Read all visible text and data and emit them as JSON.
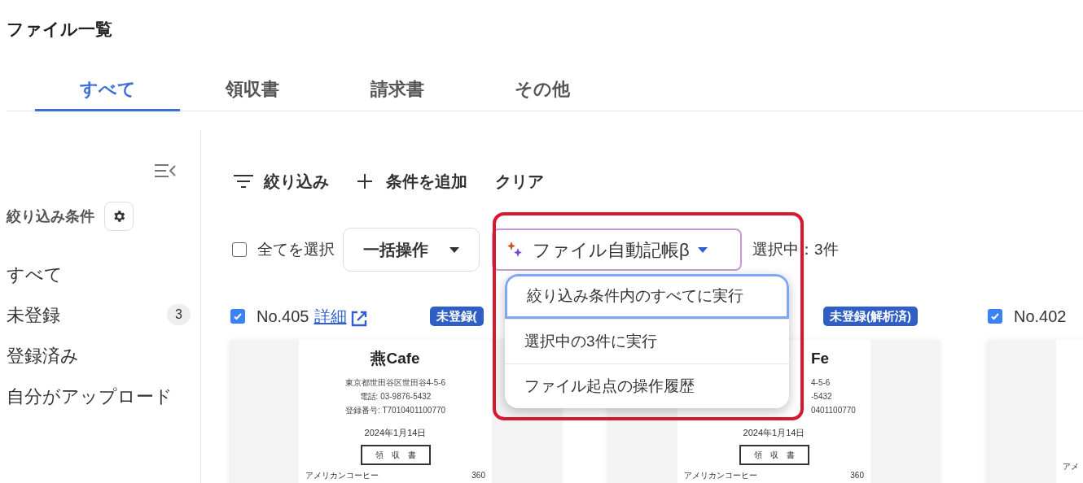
{
  "page": {
    "title": "ファイル一覧"
  },
  "tabs": [
    {
      "label": "すべて",
      "selected": true
    },
    {
      "label": "領収書",
      "selected": false
    },
    {
      "label": "請求書",
      "selected": false
    },
    {
      "label": "その他",
      "selected": false
    }
  ],
  "sidebar": {
    "heading": "絞り込み条件",
    "items": [
      {
        "label": "すべて"
      },
      {
        "label": "未登録",
        "count": "3"
      },
      {
        "label": "登録済み"
      },
      {
        "label": "自分がアップロード"
      }
    ]
  },
  "filter_bar": {
    "filter": "絞り込み",
    "add": "条件を追加",
    "clear": "クリア"
  },
  "actions": {
    "select_all": {
      "label": "全てを選択",
      "checked": false
    },
    "bulk": "一括操作",
    "auto": "ファイル自動記帳β",
    "selection": "選択中：3件"
  },
  "menu": {
    "items": [
      {
        "label": "絞り込み条件内のすべてに実行",
        "selected": true
      },
      {
        "label": "選択中の3件に実行",
        "selected": false
      },
      {
        "label": "ファイル起点の操作履歴",
        "selected": false
      }
    ]
  },
  "cards": [
    {
      "checked": true,
      "number": "No.405",
      "link": "詳細",
      "badge": "未登録(",
      "covered": false,
      "receipt": [
        {
          "kind": "shop",
          "text": "燕Cafe"
        },
        {
          "kind": "line",
          "text": "東京都世田谷区世田谷4-5-6"
        },
        {
          "kind": "line",
          "text": "電話: 03-9876-5432"
        },
        {
          "kind": "line",
          "text": "登録番号: T7010401100770"
        },
        {
          "kind": "date",
          "text": "2024年1月14日"
        },
        {
          "kind": "title",
          "text": "領　収　書"
        },
        {
          "kind": "item",
          "text": "アメリカンコーヒー",
          "price": "360"
        }
      ]
    },
    {
      "badge": "未登録(解析済)",
      "covered": true,
      "receipt": [
        {
          "kind": "shop",
          "text": "Fe"
        },
        {
          "kind": "line",
          "text": "4-5-6"
        },
        {
          "kind": "line",
          "text": "-5432"
        },
        {
          "kind": "line",
          "text": "0401100770"
        },
        {
          "kind": "date",
          "text": "2024年1月14日"
        },
        {
          "kind": "title",
          "text": "領　収　書"
        },
        {
          "kind": "item",
          "text": "アメリカンコーヒー",
          "price": "360"
        }
      ]
    },
    {
      "checked": true,
      "number": "No.402",
      "covered": false,
      "receipt": [
        {
          "kind": "item",
          "text": "アメ"
        }
      ]
    }
  ]
}
